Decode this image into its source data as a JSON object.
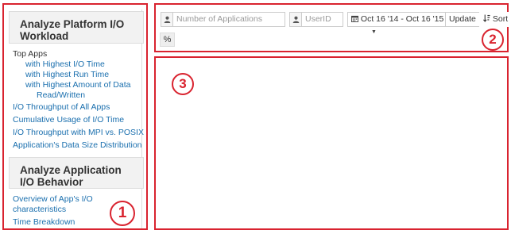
{
  "sidebar": {
    "section1_title": "Analyze Platform I/O Workload",
    "top_apps_label": "Top Apps",
    "top_apps_items": [
      "with Highest I/O Time",
      "with Highest Run Time",
      "with Highest Amount of Data",
      "Read/Written"
    ],
    "links": [
      "I/O Throughput of All Apps",
      "Cumulative Usage of I/O Time",
      "I/O Throughput with MPI vs. POSIX",
      "Application's Data Size Distribution"
    ],
    "section2_title": "Analyze Application I/O Behavior",
    "section2_links": [
      "Overview of App's I/O",
      "characteristics",
      "Time Breakdown"
    ]
  },
  "toolbar": {
    "apps_placeholder": "Number of Applications",
    "userid_placeholder": "UserID",
    "date_range": "Oct 16 '14 - Oct 16 '15",
    "update_label": "Update",
    "sort_label": "Sort",
    "percent_label": "%"
  },
  "annotations": {
    "region1": "1",
    "region2": "2",
    "region3": "3"
  },
  "colors": {
    "annotation_red": "#d9232f",
    "link_blue": "#1a6fae",
    "header_bg": "#f2f2f2"
  }
}
